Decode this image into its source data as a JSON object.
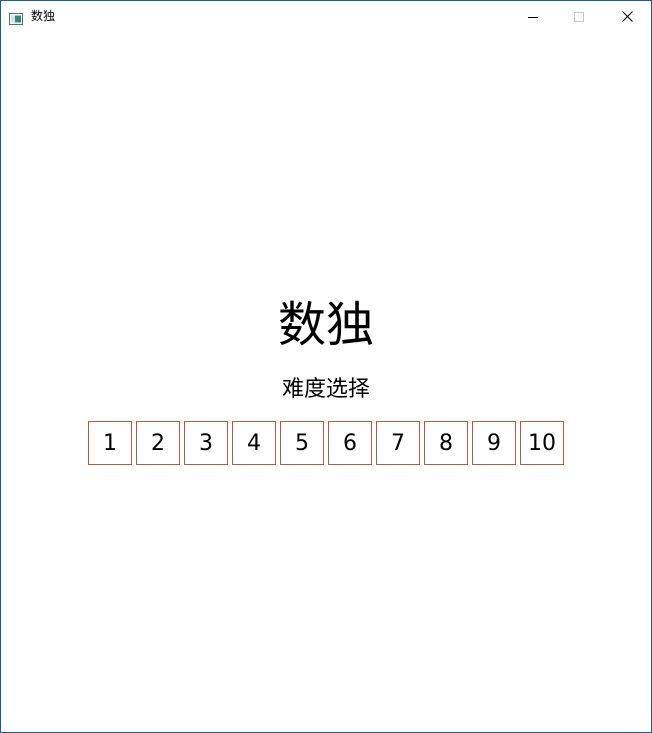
{
  "window": {
    "title": "数独",
    "controls": {
      "minimize": "minimize-icon",
      "maximize": "maximize-icon",
      "close": "close-icon"
    }
  },
  "main": {
    "title": "数独",
    "subtitle": "难度选择",
    "levels": [
      "1",
      "2",
      "3",
      "4",
      "5",
      "6",
      "7",
      "8",
      "9",
      "10"
    ]
  },
  "colors": {
    "window_border": "#1d5e8a",
    "level_border": "#b05a42",
    "background": "#ffffff"
  }
}
